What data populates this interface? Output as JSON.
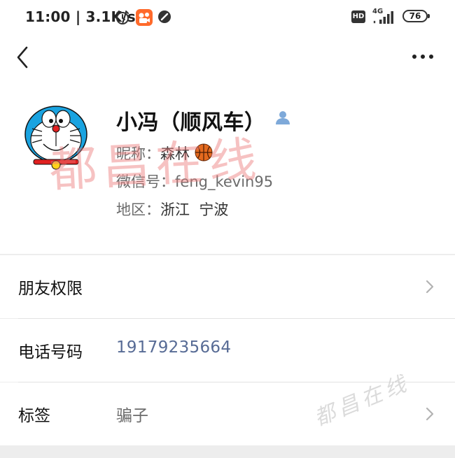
{
  "status_bar": {
    "time": "11:00 | 3.1K/s",
    "network": "4G",
    "hd": "HD",
    "battery": "76"
  },
  "profile": {
    "name": "小冯（顺风车）",
    "nickname_label": "昵称：",
    "nickname": "森林",
    "wechat_id_label": "微信号：",
    "wechat_id": "feng_kevin95",
    "region_label": "地区：",
    "region": "浙江  宁波"
  },
  "rows": {
    "friend_permissions": {
      "label": "朋友权限"
    },
    "phone": {
      "label": "电话号码",
      "value": "19179235664",
      "value_color": "#576b95"
    },
    "tags": {
      "label": "标签",
      "value": "骗子"
    }
  },
  "watermarks": {
    "main": "都昌在线",
    "corner": "都昌在线"
  },
  "colors": {
    "link": "#576b95",
    "watermark": "#f0a0a0",
    "background": "#ededed"
  }
}
